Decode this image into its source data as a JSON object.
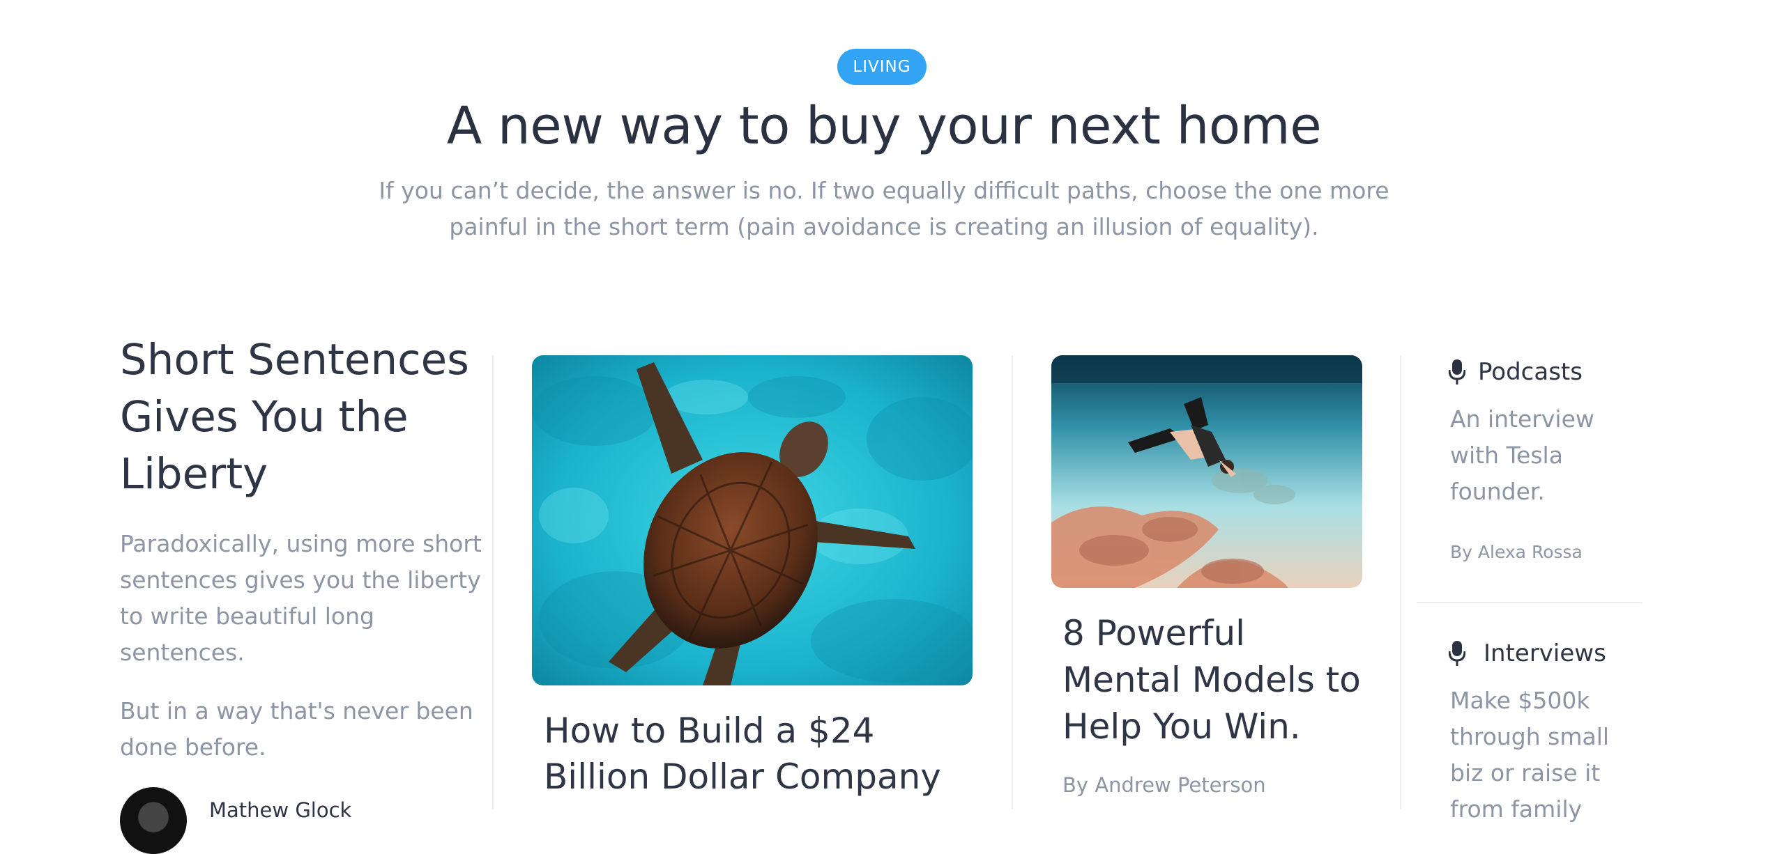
{
  "hero": {
    "tag": "LIVING",
    "title": "A new way to buy your next home",
    "subtitle": "If you can’t decide, the answer is no. If two equally difficult paths, choose the one more painful in the short term (pain avoidance is creating an illusion of equality)."
  },
  "feature": {
    "title": "Short Sentences Gives You the Liberty",
    "paragraph1": "Paradoxically, using more short sentences gives you the liberty to write beautiful long sentences.",
    "paragraph2": "But in a way that's never been done before.",
    "author": "Mathew Glock"
  },
  "card_turtle": {
    "image_icon": "sea-turtle-photo",
    "title": "How to Build a $24 Billion Dollar Company"
  },
  "card_diver": {
    "image_icon": "free-diver-photo",
    "title": "8 Powerful Mental Models to Help You Win.",
    "author": "By Andrew Peterson"
  },
  "sidebar": {
    "items": [
      {
        "icon": "microphone-icon",
        "heading": "Podcasts",
        "text": "An interview with Tesla founder.",
        "byline": "By Alexa Rossa"
      },
      {
        "icon": "microphone-icon",
        "heading": "Interviews",
        "text": "Make $500k through small biz or raise it from family"
      }
    ]
  },
  "colors": {
    "accent": "#33a3f4",
    "heading": "#2f3545",
    "muted": "#8d94a3",
    "divider": "#eceef2"
  }
}
